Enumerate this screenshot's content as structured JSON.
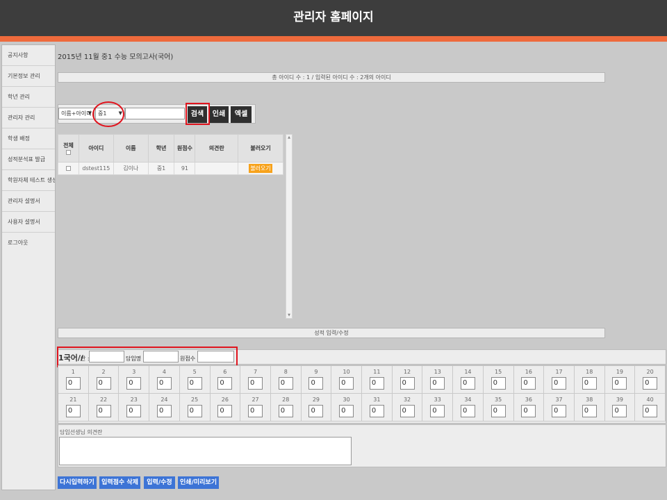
{
  "header": {
    "title": "관리자 홈페이지"
  },
  "sidebar": {
    "items": [
      {
        "label": "공지사항"
      },
      {
        "label": "기본정보 관리"
      },
      {
        "label": "학년 관리"
      },
      {
        "label": "관리자 관리"
      },
      {
        "label": "학생 배정"
      },
      {
        "label": "성적분석표 발급"
      },
      {
        "label": "학원자체 테스트 생성"
      },
      {
        "label": "관리자 설명서"
      },
      {
        "label": "사용자 설명서"
      },
      {
        "label": "로그아웃"
      }
    ]
  },
  "page": {
    "title": "2015년 11월 중1 수능 모의고사(국어)"
  },
  "summary": {
    "text": "총 아이디 수 : 1 / 입력된 아이디 수 : 2개의 아이디"
  },
  "search": {
    "type_value": "이름+아이디",
    "grade_value": "중1",
    "input_value": "",
    "search_label": "검색",
    "print_label": "인쇄",
    "excel_label": "엑셀"
  },
  "table": {
    "headers": {
      "all": "전체",
      "id": "아이디",
      "name": "이름",
      "grade": "학년",
      "raw_score": "원점수",
      "opinion": "의견란",
      "load": "불러오기"
    },
    "rows": [
      {
        "id": "dstest115",
        "name": "김이나",
        "grade": "중1",
        "raw_score": "91",
        "opinion": "",
        "load_label": "불러오기"
      }
    ]
  },
  "section": {
    "title": "성적 입력/수정"
  },
  "form": {
    "subject": "1국어//",
    "class_label": "반 :",
    "teacher_label": "담임명 :",
    "raw_score_label": "원점수 :"
  },
  "answers": [
    {
      "num": "1",
      "value": "0"
    },
    {
      "num": "2",
      "value": "0"
    },
    {
      "num": "3",
      "value": "0"
    },
    {
      "num": "4",
      "value": "0"
    },
    {
      "num": "5",
      "value": "0"
    },
    {
      "num": "6",
      "value": "0"
    },
    {
      "num": "7",
      "value": "0"
    },
    {
      "num": "8",
      "value": "0"
    },
    {
      "num": "9",
      "value": "0"
    },
    {
      "num": "10",
      "value": "0"
    },
    {
      "num": "11",
      "value": "0"
    },
    {
      "num": "12",
      "value": "0"
    },
    {
      "num": "13",
      "value": "0"
    },
    {
      "num": "14",
      "value": "0"
    },
    {
      "num": "15",
      "value": "0"
    },
    {
      "num": "16",
      "value": "0"
    },
    {
      "num": "17",
      "value": "0"
    },
    {
      "num": "18",
      "value": "0"
    },
    {
      "num": "19",
      "value": "0"
    },
    {
      "num": "20",
      "value": "0"
    },
    {
      "num": "21",
      "value": "0"
    },
    {
      "num": "22",
      "value": "0"
    },
    {
      "num": "23",
      "value": "0"
    },
    {
      "num": "24",
      "value": "0"
    },
    {
      "num": "25",
      "value": "0"
    },
    {
      "num": "26",
      "value": "0"
    },
    {
      "num": "27",
      "value": "0"
    },
    {
      "num": "28",
      "value": "0"
    },
    {
      "num": "29",
      "value": "0"
    },
    {
      "num": "30",
      "value": "0"
    },
    {
      "num": "31",
      "value": "0"
    },
    {
      "num": "32",
      "value": "0"
    },
    {
      "num": "33",
      "value": "0"
    },
    {
      "num": "34",
      "value": "0"
    },
    {
      "num": "35",
      "value": "0"
    },
    {
      "num": "36",
      "value": "0"
    },
    {
      "num": "37",
      "value": "0"
    },
    {
      "num": "38",
      "value": "0"
    },
    {
      "num": "39",
      "value": "0"
    },
    {
      "num": "40",
      "value": "0"
    }
  ],
  "opinion": {
    "label": "담임선생님 의견란"
  },
  "actions": {
    "reenter": "다시입력하기",
    "delete_scores": "입력점수 삭제",
    "edit": "입력/수정",
    "print_preview": "인쇄/미리보기"
  },
  "colors": {
    "header_bg": "#3d3d3d",
    "accent": "#ee6a3c",
    "highlight": "#e0141e",
    "load_button": "#f7a21b",
    "action_button": "#3d74d6"
  }
}
